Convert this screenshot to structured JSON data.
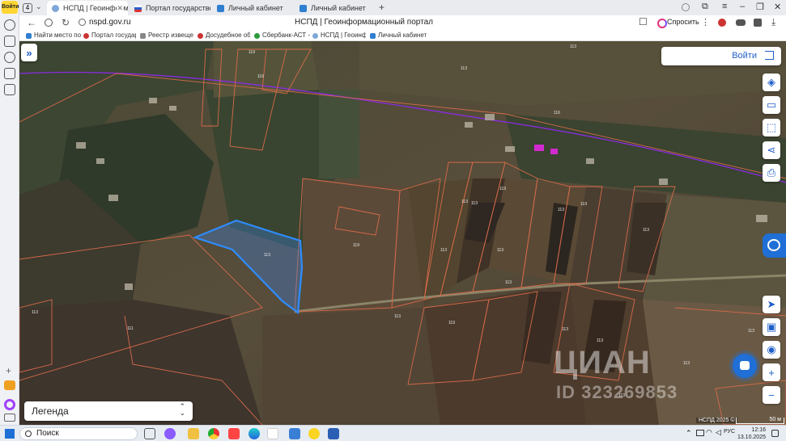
{
  "browser": {
    "rail_badge": "Войти",
    "tab_count": "4",
    "tabs": [
      {
        "label": "НСПД | Геоинформаци",
        "active": true
      },
      {
        "label": "Портал государственны"
      },
      {
        "label": "Личный кабинет"
      },
      {
        "label": "Личный кабинет"
      }
    ],
    "new_tab": "+",
    "url": "nspd.gov.ru",
    "page_title": "НСПД | Геоинформационный портал",
    "ask_label": "Спросить",
    "bookmarks": [
      "Найти место по к",
      "Портал государс",
      "Реестр извещени",
      "Досудебное обж",
      "Сбербанк-АСТ -",
      "НСПД | Геоинфор",
      "Личный кабинет"
    ]
  },
  "map": {
    "login_label": "Войти",
    "legend_label": "Легенда",
    "legend_chevrons": "⌃⌄",
    "expand_glyph": "»",
    "tools": [
      "layers-icon",
      "ruler-icon",
      "select-area-icon",
      "share-icon",
      "print-icon"
    ],
    "nav_tools": [
      "locate-icon",
      "layers-view-icon",
      "street-view-icon",
      "zoom-in-icon",
      "zoom-out-icon"
    ],
    "zoom_in": "+",
    "zoom_out": "−",
    "watermark": "ЦИАН",
    "watermark_id": "ID 323269853",
    "attribution": "НСПД 2025 ©",
    "scale": "50 м",
    "parcel_labels": [
      "119",
      "116",
      "113",
      "113",
      "116",
      "113",
      "119",
      "113",
      "113",
      "119",
      "113",
      "113",
      "119",
      "113",
      "113",
      "119",
      "113",
      "113",
      "113",
      "111",
      "113",
      "113",
      "113",
      "113",
      "113"
    ],
    "colors": {
      "accent": "#1f5ec7",
      "selected_parcel": "#2f8cff",
      "parcel_border": "#d66a4a",
      "road": "#8a2be2"
    }
  },
  "taskbar": {
    "search_label": "Поиск",
    "lang": "РУС",
    "time": "12:16",
    "date": "13.10.2025"
  }
}
